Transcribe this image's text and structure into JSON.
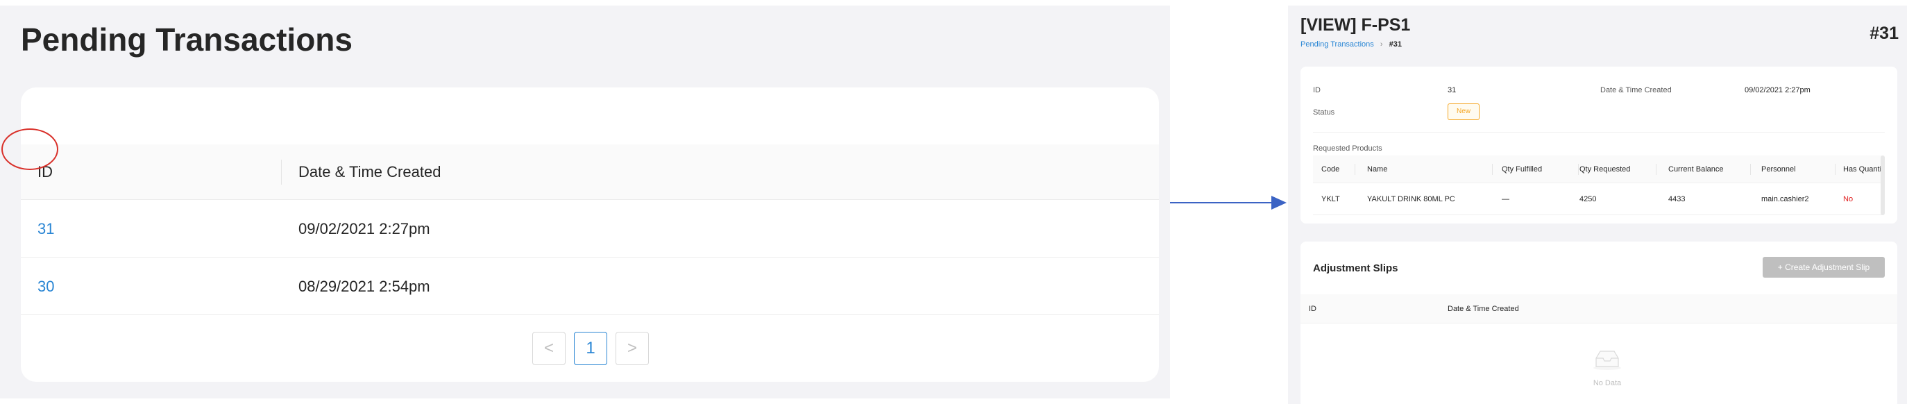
{
  "left": {
    "title": "Pending Transactions",
    "columns": [
      "ID",
      "Date & Time Created"
    ],
    "rows": [
      {
        "id": "31",
        "date": "09/02/2021 2:27pm"
      },
      {
        "id": "30",
        "date": "08/29/2021 2:54pm"
      }
    ],
    "pagination": {
      "prev": "<",
      "current": "1",
      "next": ">"
    }
  },
  "right": {
    "title": "[VIEW] F-PS1",
    "breadcrumb": {
      "parent": "Pending Transactions",
      "separator": "›",
      "current": "#31"
    },
    "number": "#31",
    "info": {
      "id_label": "ID",
      "id_value": "31",
      "date_label": "Date & Time Created",
      "date_value": "09/02/2021 2:27pm",
      "status_label": "Status",
      "status_value": "New"
    },
    "requested_products": {
      "label": "Requested Products",
      "columns": [
        "Code",
        "Name",
        "Qty Fulfilled",
        "Qty Requested",
        "Current Balance",
        "Personnel",
        "Has Quantity"
      ],
      "rows": [
        {
          "code": "YKLT",
          "name": "YAKULT DRINK 80ML PC",
          "qty_fulfilled": "—",
          "qty_requested": "4250",
          "current_balance": "4433",
          "personnel": "main.cashier2",
          "has_quantity": "No"
        }
      ]
    },
    "adjustment_slips": {
      "title": "Adjustment Slips",
      "create_button": "+ Create Adjustment Slip",
      "columns": [
        "ID",
        "Date & Time Created"
      ],
      "empty_text": "No Data"
    }
  },
  "colors": {
    "accent": "#2a86d4",
    "annotation": "#d9302a",
    "arrow": "#3b63c4",
    "status_new": "#f5a623",
    "negative": "#e02020"
  }
}
